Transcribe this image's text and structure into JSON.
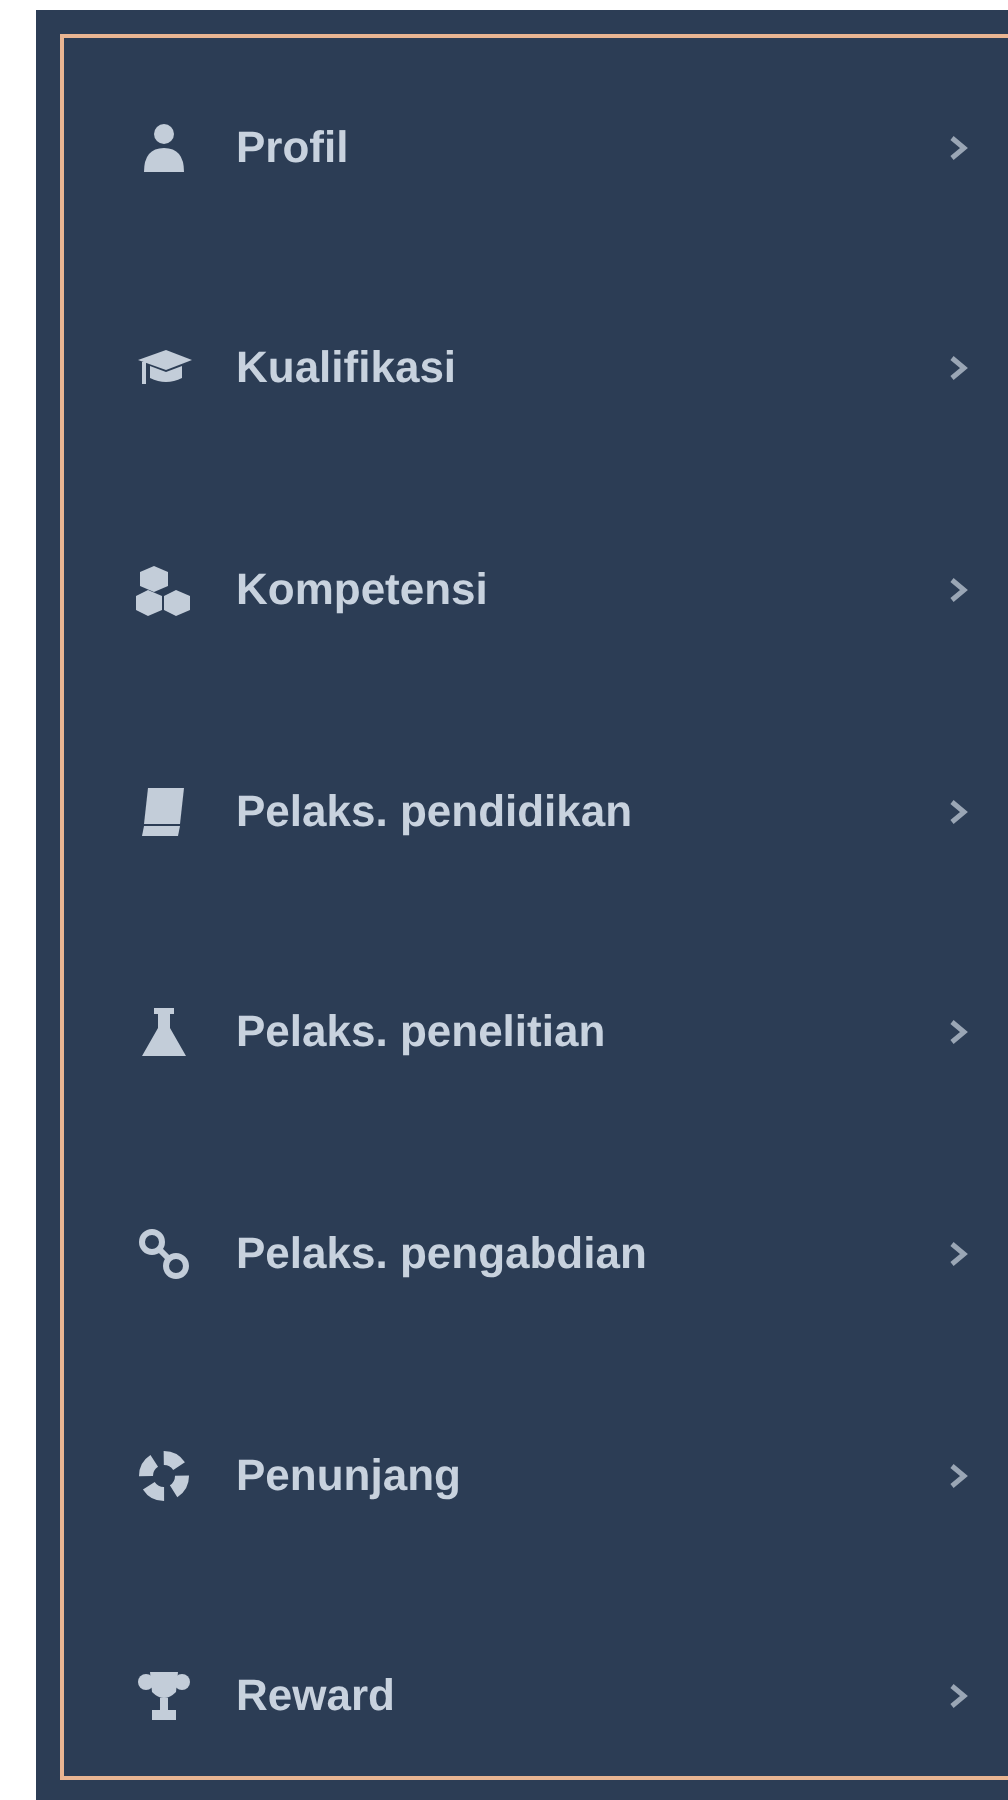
{
  "sidebar": {
    "items": [
      {
        "label": "Profil",
        "kind": "user"
      },
      {
        "label": "Kualifikasi",
        "kind": "cap"
      },
      {
        "label": "Kompetensi",
        "kind": "cubes"
      },
      {
        "label": "Pelaks. pendidikan",
        "kind": "book"
      },
      {
        "label": "Pelaks. penelitian",
        "kind": "flask"
      },
      {
        "label": "Pelaks. pengabdian",
        "kind": "link"
      },
      {
        "label": "Penunjang",
        "kind": "ring"
      },
      {
        "label": "Reward",
        "kind": "trophy"
      }
    ]
  }
}
